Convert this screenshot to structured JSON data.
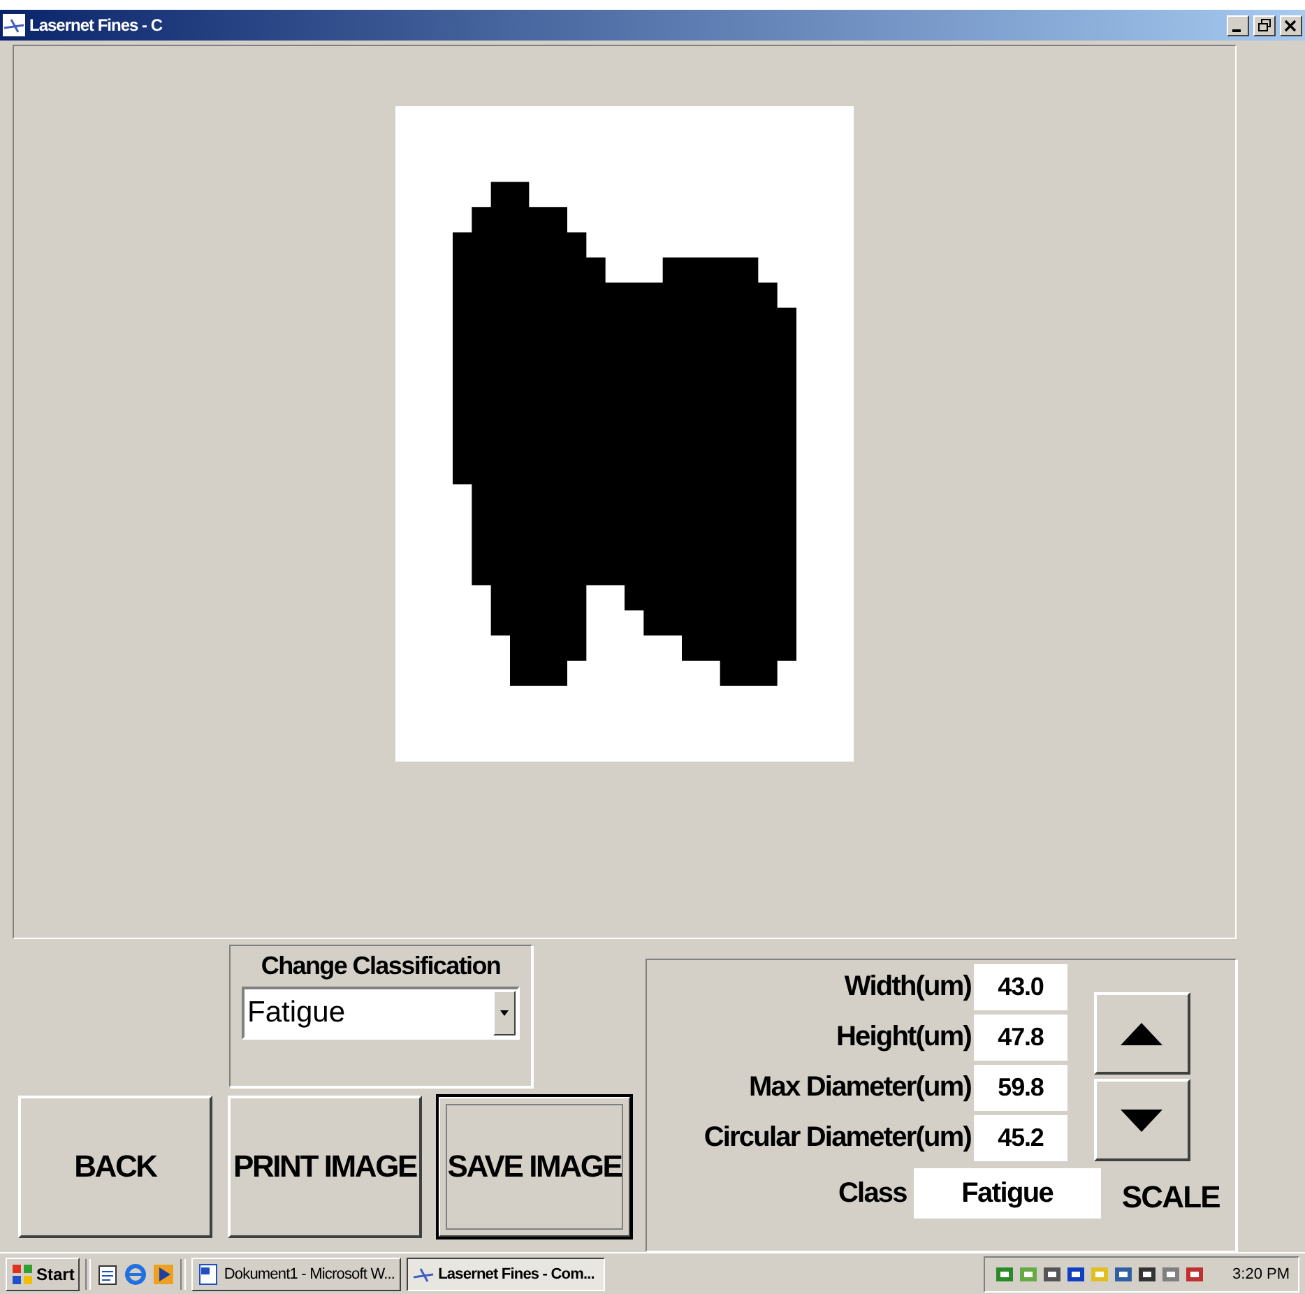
{
  "window": {
    "title": "Lasernet Fines - C"
  },
  "classification": {
    "label": "Change Classification",
    "value": "Fatigue"
  },
  "buttons": [
    {
      "label": "BACK",
      "default": false
    },
    {
      "label": "PRINT IMAGE",
      "default": false
    },
    {
      "label": "SAVE IMAGE",
      "default": true
    }
  ],
  "measurements": [
    {
      "label": "Width(um)",
      "value": "43.0"
    },
    {
      "label": "Height(um)",
      "value": "47.8"
    },
    {
      "label": "Max Diameter(um)",
      "value": "59.8"
    },
    {
      "label": "Circular Diameter(um)",
      "value": "45.2"
    }
  ],
  "class": {
    "label": "Class",
    "value": "Fatigue"
  },
  "scale": {
    "label": "SCALE"
  },
  "taskbar": {
    "start": "Start",
    "tasks": [
      {
        "label": "Dokument1 - Microsoft W...",
        "kind": "document",
        "selected": false
      },
      {
        "label": "Lasernet Fines - Com...",
        "kind": "app",
        "selected": true
      }
    ],
    "clock": "3:20 PM"
  }
}
